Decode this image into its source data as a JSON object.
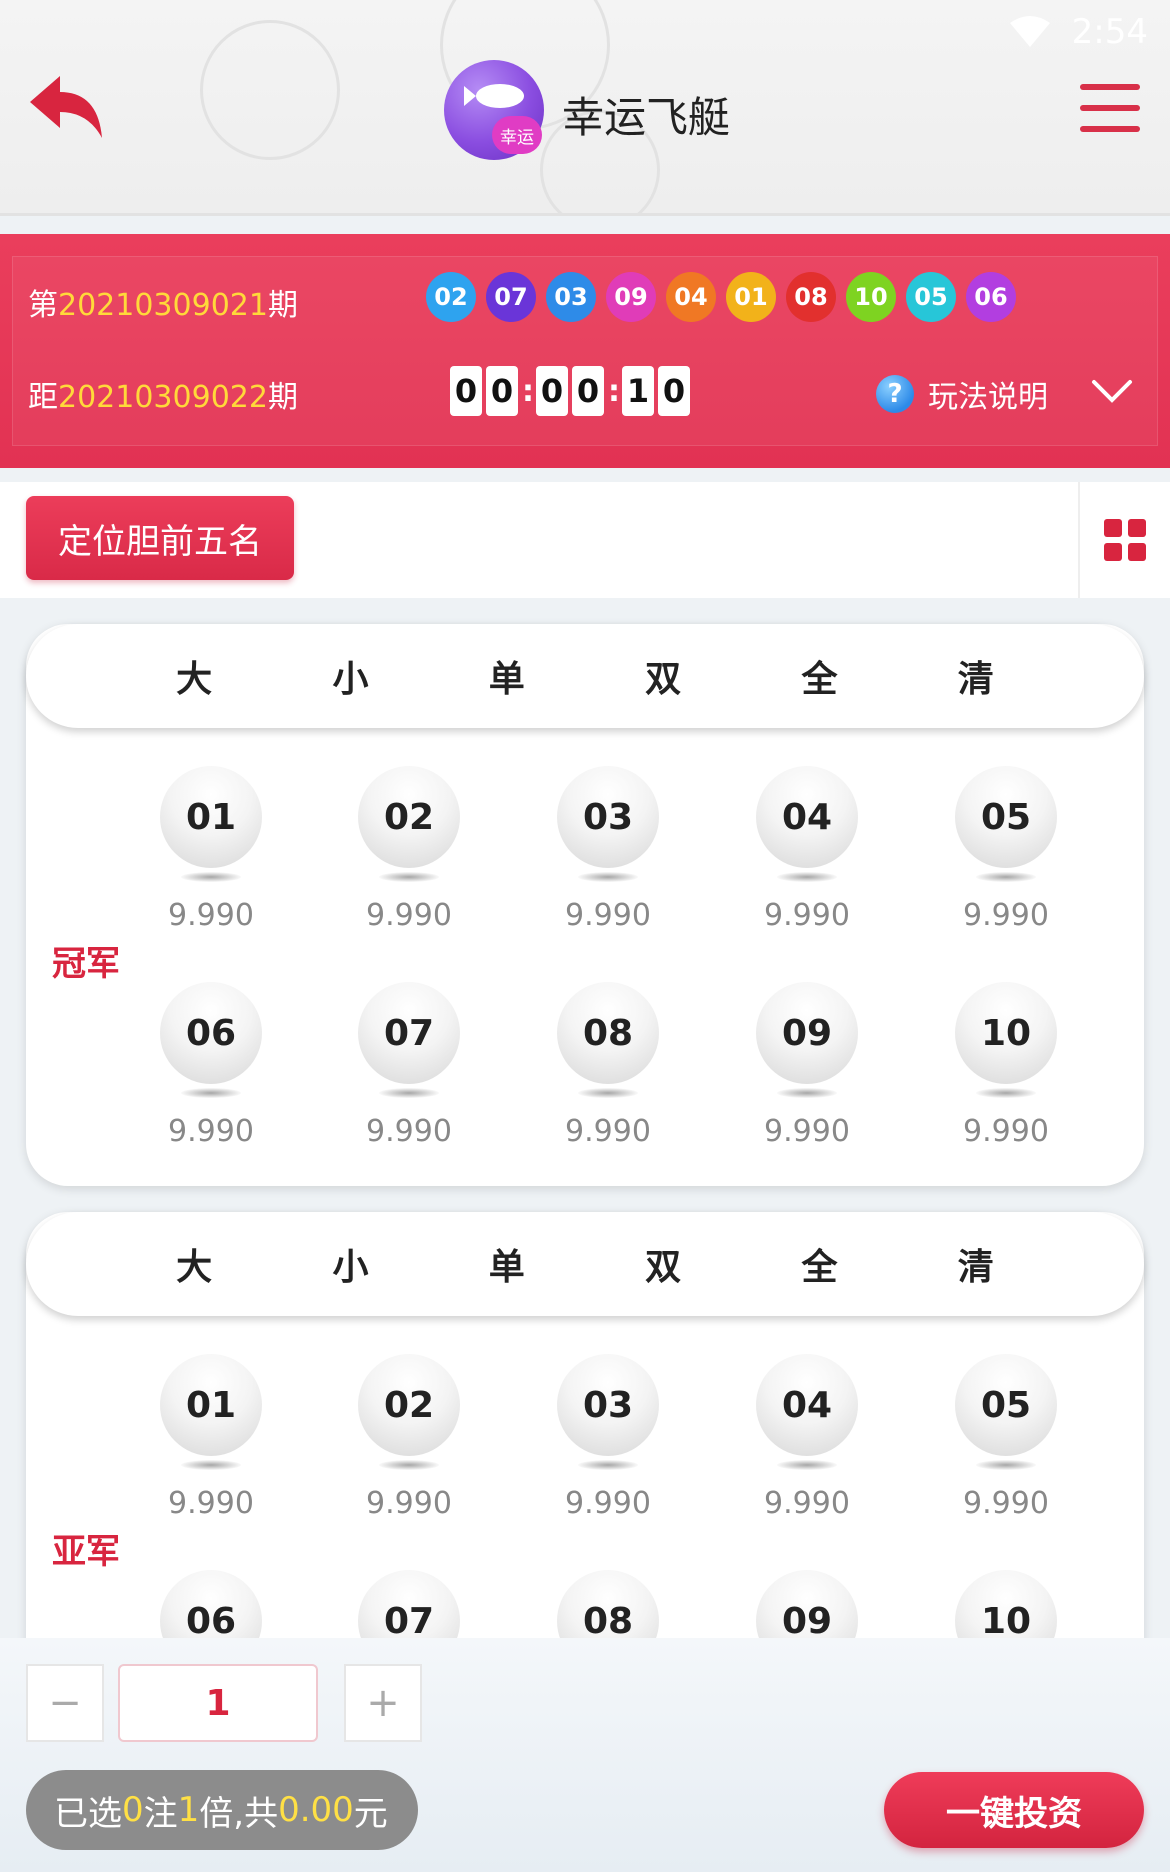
{
  "status": {
    "time": "2:54"
  },
  "header": {
    "title": "幸运飞艇",
    "logo_badge": "幸运"
  },
  "draw": {
    "current_prefix": "第",
    "current_period": "20210309021",
    "current_suffix": "期",
    "next_prefix": "距",
    "next_period": "20210309022",
    "next_suffix": "期",
    "results": [
      {
        "num": "02",
        "color": "#2ea3ef"
      },
      {
        "num": "07",
        "color": "#6a35d8"
      },
      {
        "num": "03",
        "color": "#2e8be8"
      },
      {
        "num": "09",
        "color": "#e03cb8"
      },
      {
        "num": "04",
        "color": "#f07824"
      },
      {
        "num": "01",
        "color": "#f2b21a"
      },
      {
        "num": "08",
        "color": "#e2302e"
      },
      {
        "num": "10",
        "color": "#7ed321"
      },
      {
        "num": "05",
        "color": "#27c6d8"
      },
      {
        "num": "06",
        "color": "#b23ee0"
      }
    ],
    "countdown": [
      "0",
      "0",
      "0",
      "0",
      "1",
      "0"
    ],
    "help_label": "玩法说明"
  },
  "mode": {
    "label": "定位胆前五名"
  },
  "quick_buttons": [
    "大",
    "小",
    "单",
    "双",
    "全",
    "清"
  ],
  "panels": [
    {
      "rank": "冠军",
      "balls": [
        {
          "num": "01",
          "odds": "9.990"
        },
        {
          "num": "02",
          "odds": "9.990"
        },
        {
          "num": "03",
          "odds": "9.990"
        },
        {
          "num": "04",
          "odds": "9.990"
        },
        {
          "num": "05",
          "odds": "9.990"
        },
        {
          "num": "06",
          "odds": "9.990"
        },
        {
          "num": "07",
          "odds": "9.990"
        },
        {
          "num": "08",
          "odds": "9.990"
        },
        {
          "num": "09",
          "odds": "9.990"
        },
        {
          "num": "10",
          "odds": "9.990"
        }
      ]
    },
    {
      "rank": "亚军",
      "balls": [
        {
          "num": "01",
          "odds": "9.990"
        },
        {
          "num": "02",
          "odds": "9.990"
        },
        {
          "num": "03",
          "odds": "9.990"
        },
        {
          "num": "04",
          "odds": "9.990"
        },
        {
          "num": "05",
          "odds": "9.990"
        },
        {
          "num": "06",
          "odds": ""
        },
        {
          "num": "07",
          "odds": ""
        },
        {
          "num": "08",
          "odds": ""
        },
        {
          "num": "09",
          "odds": ""
        },
        {
          "num": "10",
          "odds": ""
        }
      ]
    }
  ],
  "bottom": {
    "minus": "−",
    "plus": "+",
    "multiplier": "1",
    "summary": {
      "a": "已选",
      "count": "0",
      "b": "注 ",
      "mult": "1",
      "c": "倍,共",
      "amount": "0.00",
      "d": "元"
    },
    "invest_label": "一键投资"
  }
}
